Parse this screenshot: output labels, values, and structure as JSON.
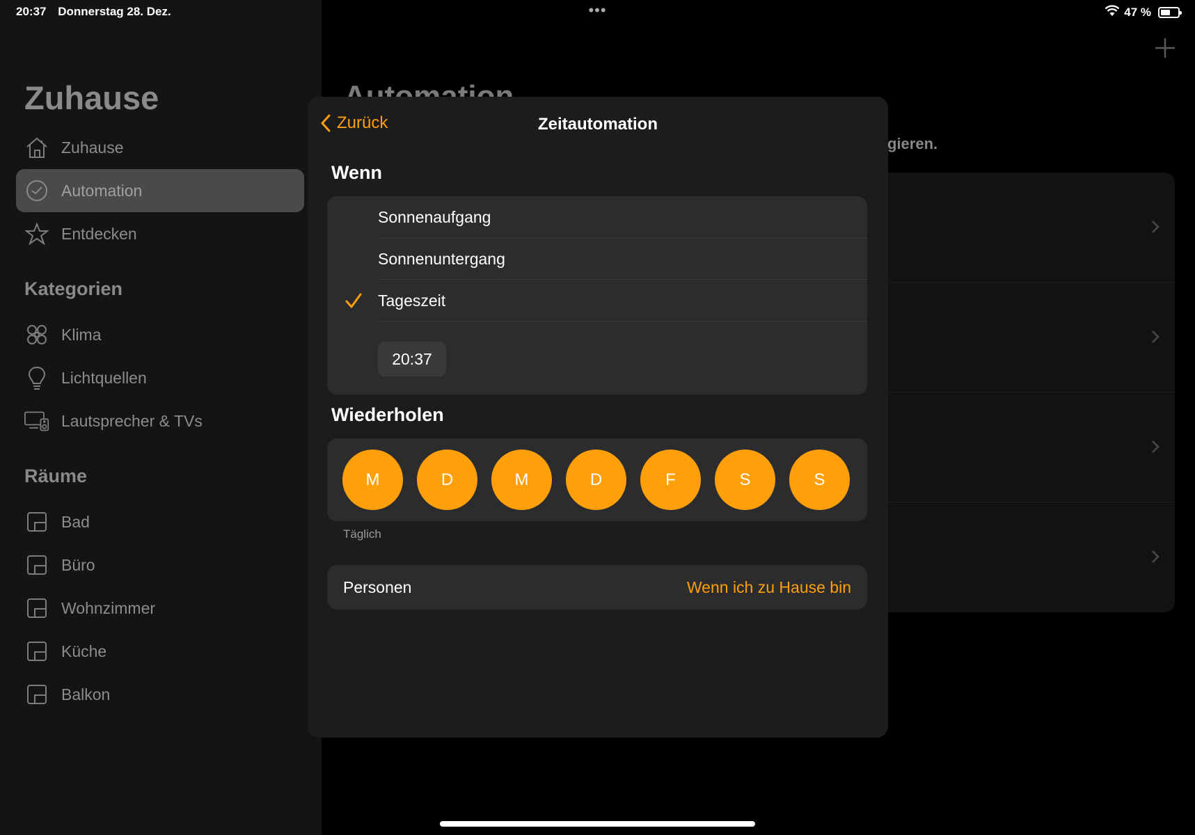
{
  "status_bar": {
    "time": "20:37",
    "date": "Donnerstag 28. Dez.",
    "dots": "•••",
    "battery": "47 %",
    "battery_level": 0.47
  },
  "sidebar": {
    "title": "Zuhause",
    "items": [
      {
        "label": "Zuhause",
        "icon": "house-icon"
      },
      {
        "label": "Automation",
        "icon": "clock-icon",
        "active": true
      },
      {
        "label": "Entdecken",
        "icon": "star-icon"
      }
    ],
    "categories_title": "Kategorien",
    "categories": [
      {
        "label": "Klima",
        "icon": "fan-icon"
      },
      {
        "label": "Lichtquellen",
        "icon": "lightbulb-icon"
      },
      {
        "label": "Lautsprecher & TVs",
        "icon": "speaker-tv-icon"
      }
    ],
    "rooms_title": "Räume",
    "rooms": [
      {
        "label": "Bad"
      },
      {
        "label": "Büro"
      },
      {
        "label": "Wohnzimmer"
      },
      {
        "label": "Küche"
      },
      {
        "label": "Balkon"
      }
    ]
  },
  "main": {
    "title": "Automation",
    "description_fragment": "gieren."
  },
  "sheet": {
    "back_label": "Zurück",
    "title": "Zeitautomation",
    "when_heading": "Wenn",
    "options": [
      {
        "label": "Sonnenaufgang",
        "selected": false
      },
      {
        "label": "Sonnenuntergang",
        "selected": false
      },
      {
        "label": "Tageszeit",
        "selected": true
      }
    ],
    "time_value": "20:37",
    "repeat_heading": "Wiederholen",
    "days": [
      "M",
      "D",
      "M",
      "D",
      "F",
      "S",
      "S"
    ],
    "repeat_note": "Täglich",
    "persons_label": "Personen",
    "persons_value": "Wenn ich zu Hause bin"
  },
  "colors": {
    "accent": "#ff9f0a",
    "sheet_bg": "#1c1c1e",
    "group_bg": "#2c2c2e"
  }
}
